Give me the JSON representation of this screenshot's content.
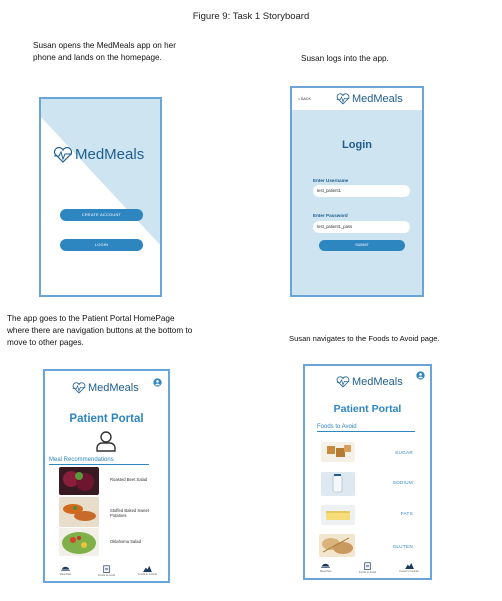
{
  "figure_title": "Figure 9: Task 1 Storyboard",
  "captions": {
    "step1": "Susan opens the MedMeals app on her phone and lands on the homepage.",
    "step2": "Susan logs into the app.",
    "step3": "The app goes to the Patient Portal HomePage where there are navigation buttons at the bottom to move to other pages.",
    "step4": "Susan navigates to the Foods to Avoid page."
  },
  "app_name": "MedMeals",
  "colors": {
    "brand_dark": "#1f5e8e",
    "accent": "#2e86c1",
    "light_blue": "#cfe4f1",
    "frame": "#6ba4d6"
  },
  "screen1": {
    "create_account": "CREATE ACCOUNT",
    "login": "LOGIN"
  },
  "screen2": {
    "back": "< BACK",
    "title": "Login",
    "username_label": "Enter Username",
    "username_value": "test_patient1",
    "password_label": "Enter Password",
    "password_value": "test_patient1_pass",
    "submit": "SUBMIT"
  },
  "screen3": {
    "title": "Patient Portal",
    "section": "Meal Recommendations",
    "meals": [
      "Roasted Beet Salad",
      "Stuffed Baked Sweet Potatoes",
      "Oklahoma Salad"
    ],
    "nav": [
      "Meal Plan",
      "Foods to Avoid",
      "Foods to Include"
    ]
  },
  "screen4": {
    "title": "Patient Portal",
    "section": "Foods to Avoid",
    "foods": [
      "SUGAR",
      "SODIUM",
      "FATS",
      "GLUTEN"
    ],
    "nav": [
      "Meal Plan",
      "Foods to Avoid",
      "Foods to Include"
    ]
  },
  "icons": [
    "heart-pulse-icon",
    "user-icon",
    "meal-plan-icon",
    "clipboard-icon",
    "foods-include-icon"
  ]
}
